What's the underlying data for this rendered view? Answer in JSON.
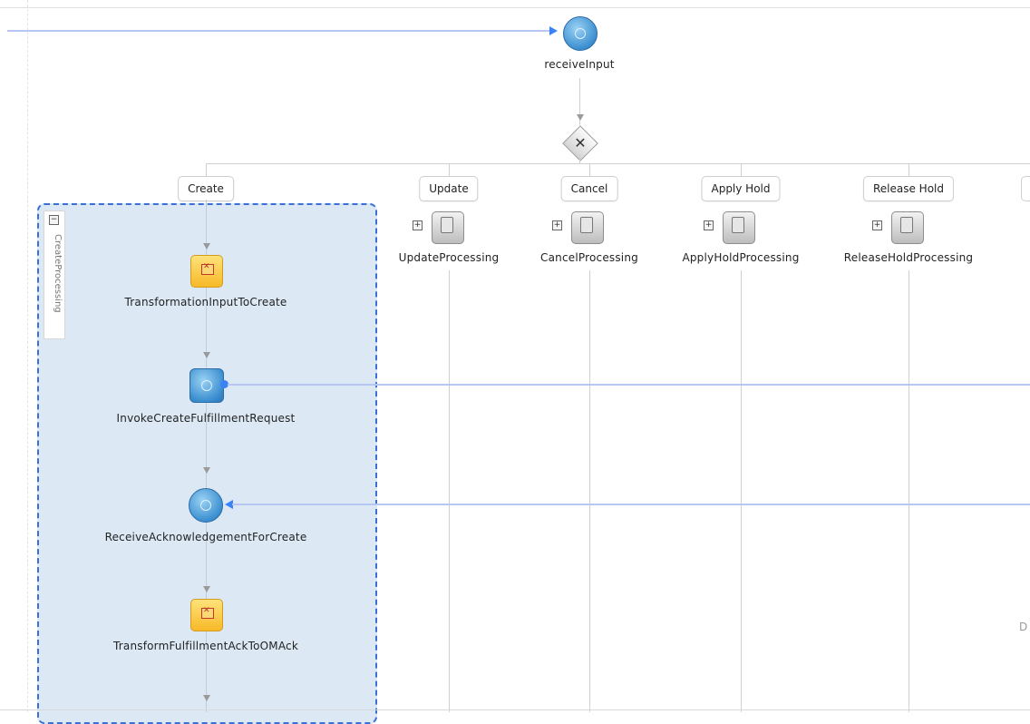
{
  "diagram": {
    "start_node": {
      "label": "receiveInput"
    },
    "cases": [
      {
        "label": "Create"
      },
      {
        "label": "Update"
      },
      {
        "label": "Cancel"
      },
      {
        "label": "Apply Hold"
      },
      {
        "label": "Release Hold"
      }
    ],
    "scope": {
      "title": "CreateProcessing",
      "steps": [
        {
          "label": "TransformationInputToCreate",
          "icon": "transform-icon"
        },
        {
          "label": "InvokeCreateFulfillmentRequest",
          "icon": "invoke-icon"
        },
        {
          "label": "ReceiveAcknowledgementForCreate",
          "icon": "receive-icon"
        },
        {
          "label": "TransformFulfillmentAckToOMAck",
          "icon": "transform-icon"
        }
      ]
    },
    "collapsed_scopes": [
      {
        "label": "UpdateProcessing"
      },
      {
        "label": "CancelProcessing"
      },
      {
        "label": "ApplyHoldProcessing"
      },
      {
        "label": "ReleaseHoldProcessing"
      }
    ],
    "edge_text": "D"
  },
  "colors": {
    "scope_bg": "#dce9f5",
    "scope_border": "#3a6fd6",
    "link_line": "#b8c6f4",
    "link_arrow": "#3b82f6"
  }
}
